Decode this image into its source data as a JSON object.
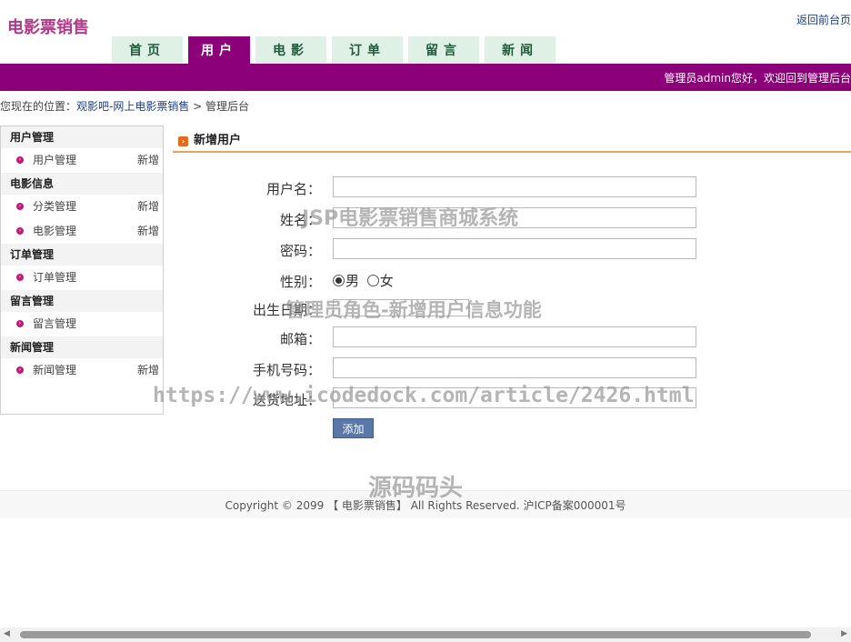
{
  "header": {
    "logo": "电影票销售",
    "top_link": "返回前台页",
    "nav_tabs": [
      {
        "label": "首页",
        "active": false
      },
      {
        "label": "用户",
        "active": true
      },
      {
        "label": "电影",
        "active": false
      },
      {
        "label": "订单",
        "active": false
      },
      {
        "label": "留言",
        "active": false
      },
      {
        "label": "新闻",
        "active": false
      }
    ],
    "welcome": "管理员admin您好，欢迎回到管理后台"
  },
  "breadcrumb": {
    "prefix": "您现在的位置：",
    "site": "观影吧-网上电影票销售",
    "sep": " > ",
    "current": "管理后台"
  },
  "sidebar": {
    "sections": [
      {
        "title": "用户管理",
        "items": [
          {
            "label": "用户管理",
            "add": "新增"
          }
        ]
      },
      {
        "title": "电影信息",
        "items": [
          {
            "label": "分类管理",
            "add": "新增"
          },
          {
            "label": "电影管理",
            "add": "新增"
          }
        ]
      },
      {
        "title": "订单管理",
        "items": [
          {
            "label": "订单管理",
            "add": ""
          }
        ]
      },
      {
        "title": "留言管理",
        "items": [
          {
            "label": "留言管理",
            "add": ""
          }
        ]
      },
      {
        "title": "新闻管理",
        "items": [
          {
            "label": "新闻管理",
            "add": "新增"
          }
        ]
      }
    ]
  },
  "main": {
    "title": "新增用户",
    "form": {
      "username_label": "用户名：",
      "name_label": "姓名：",
      "password_label": "密码：",
      "gender_label": "性别：",
      "gender_options": [
        "男",
        "女"
      ],
      "gender_selected": "男",
      "birthday_label": "出生日期：",
      "email_label": "邮箱：",
      "phone_label": "手机号码：",
      "address_label": "送货地址：",
      "submit_label": "添加"
    }
  },
  "footer": {
    "copyright": "Copyright © 2099 【 电影票销售】 All Rights Reserved. 沪ICP备案000001号"
  },
  "watermarks": {
    "line1": "JSP电影票销售商城系统",
    "line2": "管理员角色-新增用户信息功能",
    "line3": "https://www.icodedock.com/article/2426.html",
    "line4": "源码码头"
  },
  "colors": {
    "brand_purple": "#8c0079",
    "tab_bg": "#dff0e6",
    "accent_orange": "#e9a45c",
    "button_blue": "#5b77a8"
  }
}
